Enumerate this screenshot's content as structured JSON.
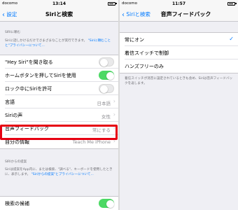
{
  "left": {
    "status": {
      "carrier": "docomo",
      "time": "13:14"
    },
    "nav": {
      "back": "設定",
      "title": "Siriと検索"
    },
    "ask_siri": {
      "header": "SIRIに頼む",
      "note_prefix": "Siriに話しかけるだけでさまざまなことが実行できます。",
      "note_link": "\"Siriに頼むことと\"プライバシーについて...",
      "rows": [
        {
          "label": "\"Hey Siri\"を聞き取る",
          "toggle": "off"
        },
        {
          "label": "ホームボタンを押してSiriを使用",
          "toggle": "on"
        },
        {
          "label": "ロック中にSiriを許可",
          "toggle": "off"
        },
        {
          "label": "言語",
          "value": "日本語"
        },
        {
          "label": "Siriの声",
          "value": "女性"
        },
        {
          "label": "音声フィードバック",
          "value": "常にする"
        },
        {
          "label": "自分の情報",
          "value": "Teach Me iPhone"
        }
      ]
    },
    "suggestions": {
      "header": "SIRIからの提案",
      "note_prefix": "Siriは提案をApp内に、または検索、\"調べる\"、キーボードを使用したときに、表示します。",
      "note_link": "\"Siriからの提案\"とプライバシーについて...",
      "rows": [
        {
          "label": "検索の候補",
          "toggle": "on"
        }
      ]
    },
    "colors": {
      "highlight": "#e60012",
      "toggle_on": "#4cd964",
      "link": "#007aff"
    }
  },
  "right": {
    "status": {
      "carrier": "docomo",
      "time": "11:57"
    },
    "nav": {
      "back": "Siriと検索",
      "title": "音声フィードバック"
    },
    "options": [
      {
        "label": "常にオン",
        "checked": true
      },
      {
        "label": "着信スイッチで制御",
        "checked": false
      },
      {
        "label": "ハンズフリーのみ",
        "checked": false
      }
    ],
    "note": "着信スイッチが消音に設定されているときも含め、Siriは音声フィードバックを返します。",
    "check_icon": "checkmark-icon"
  }
}
